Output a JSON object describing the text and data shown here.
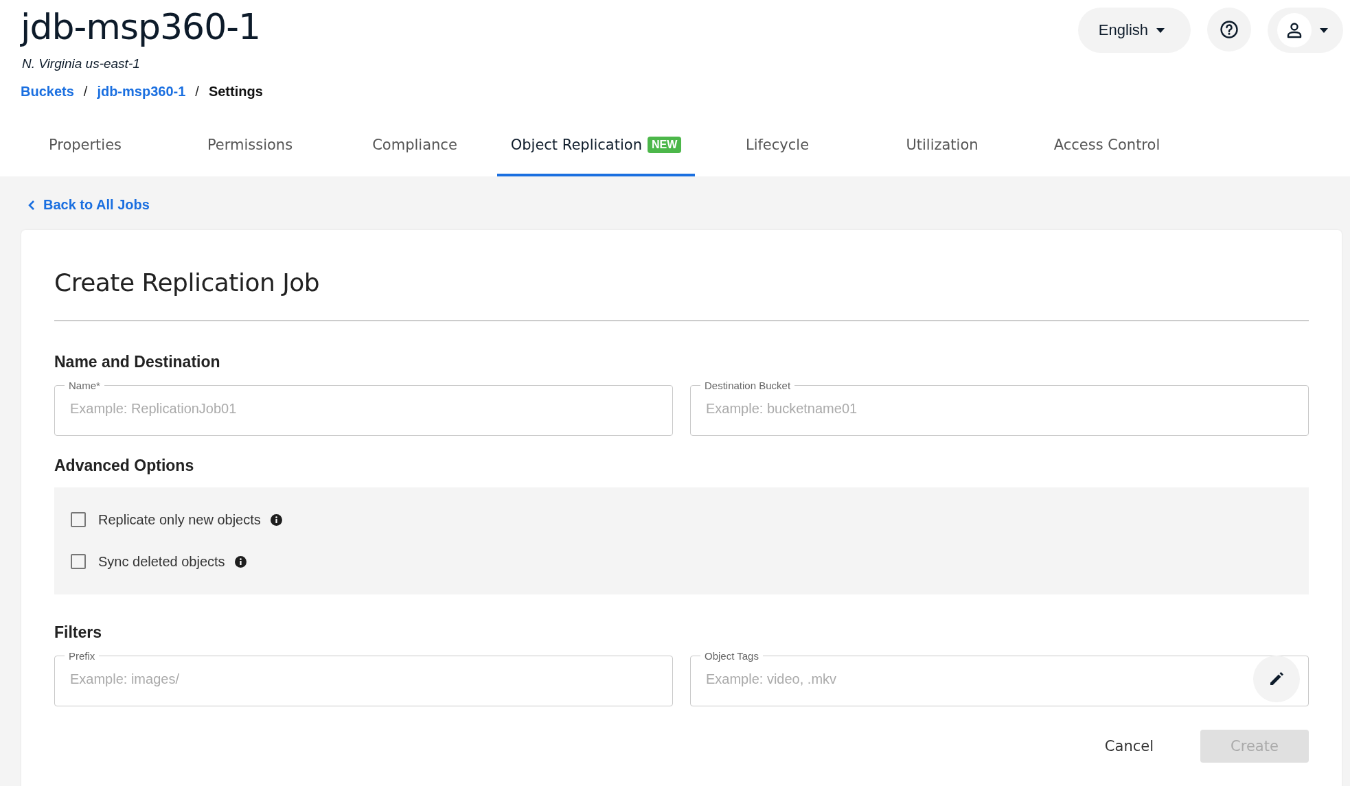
{
  "header": {
    "title": "jdb-msp360-1",
    "region": "N. Virginia us-east-1",
    "language": "English"
  },
  "breadcrumbs": [
    {
      "label": "Buckets",
      "kind": "link"
    },
    {
      "label": "/",
      "kind": "separator"
    },
    {
      "label": "jdb-msp360-1",
      "kind": "link"
    },
    {
      "label": "/",
      "kind": "separator"
    },
    {
      "label": "Settings",
      "kind": "current"
    }
  ],
  "tabs": [
    {
      "label": "Properties",
      "selected": false
    },
    {
      "label": "Permissions",
      "selected": false
    },
    {
      "label": "Compliance",
      "selected": false
    },
    {
      "label": "Object Replication",
      "selected": true,
      "badge": "NEW"
    },
    {
      "label": "Lifecycle",
      "selected": false
    },
    {
      "label": "Utilization",
      "selected": false
    },
    {
      "label": "Access Control",
      "selected": false
    }
  ],
  "back_link": "Back to All Jobs",
  "form": {
    "title": "Create Replication Job",
    "sections": [
      {
        "heading": "Name and Destination",
        "kind": "fields",
        "fields": [
          {
            "label": "Name*",
            "placeholder": "Example: ReplicationJob01",
            "kind": "plain"
          },
          {
            "label": "Destination Bucket",
            "placeholder": "Example: bucketname01",
            "kind": "plain"
          }
        ]
      },
      {
        "heading": "Advanced Options",
        "kind": "checkboxes",
        "options": [
          {
            "label": "Replicate only new objects",
            "checked": false
          },
          {
            "label": "Sync deleted objects",
            "checked": false
          }
        ]
      },
      {
        "heading": "Filters",
        "kind": "fields",
        "fields": [
          {
            "label": "Prefix",
            "placeholder": "Example: images/",
            "kind": "plain"
          },
          {
            "label": "Object Tags",
            "placeholder": "Example: video, .mkv",
            "kind": "editable"
          }
        ]
      }
    ],
    "buttons": [
      {
        "label": "Cancel",
        "kind": "text",
        "disabled": false
      },
      {
        "label": "Create",
        "kind": "filled",
        "disabled": true
      }
    ]
  }
}
